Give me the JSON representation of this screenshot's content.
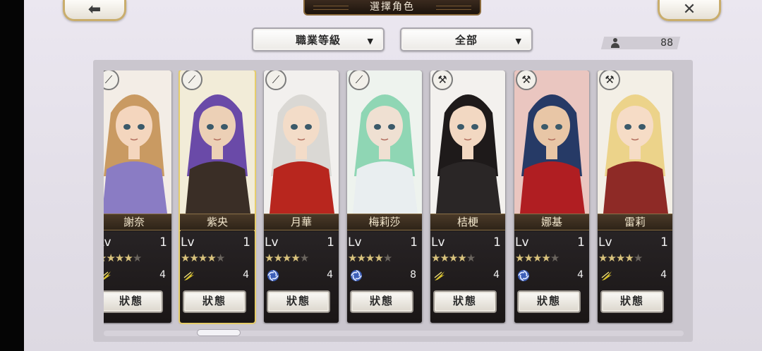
{
  "header": {
    "title": "選擇角色"
  },
  "nav": {
    "back_glyph": "⬅",
    "close_glyph": "✕"
  },
  "filters": {
    "job_level": "職業等級",
    "category": "全部",
    "arrow": "▼"
  },
  "roster": {
    "count": "88"
  },
  "colors": {
    "accent_gold": "#e6cd6a",
    "panel": "#cac6ce",
    "background": "#e7e3ec",
    "star_on": "#d8c27c",
    "star_off": "#6a655e"
  },
  "characters": [
    {
      "name": "謝奈",
      "lv_label": "Lv",
      "level": "1",
      "stars": 4,
      "max_stars": 5,
      "element": "wind",
      "element_icon": "wind-icon",
      "element_value": "4",
      "status": "狀態",
      "weapon_icon": "sword-icon",
      "selected": false
    },
    {
      "name": "紫央",
      "lv_label": "Lv",
      "level": "1",
      "stars": 4,
      "max_stars": 5,
      "element": "wind",
      "element_icon": "wind-icon",
      "element_value": "4",
      "status": "狀態",
      "weapon_icon": "sword-icon",
      "selected": true
    },
    {
      "name": "月華",
      "lv_label": "Lv",
      "level": "1",
      "stars": 4,
      "max_stars": 5,
      "element": "water",
      "element_icon": "vortex-icon",
      "element_value": "4",
      "status": "狀態",
      "weapon_icon": "sword-icon",
      "selected": false
    },
    {
      "name": "梅莉莎",
      "lv_label": "Lv",
      "level": "1",
      "stars": 4,
      "max_stars": 5,
      "element": "water",
      "element_icon": "vortex-icon",
      "element_value": "8",
      "status": "狀態",
      "weapon_icon": "sword-icon",
      "selected": false
    },
    {
      "name": "桔梗",
      "lv_label": "Lv",
      "level": "1",
      "stars": 4,
      "max_stars": 5,
      "element": "wind",
      "element_icon": "wind-icon",
      "element_value": "4",
      "status": "狀態",
      "weapon_icon": "axe-icon",
      "selected": false
    },
    {
      "name": "娜基",
      "lv_label": "Lv",
      "level": "1",
      "stars": 4,
      "max_stars": 5,
      "element": "water",
      "element_icon": "vortex-icon",
      "element_value": "4",
      "status": "狀態",
      "weapon_icon": "axe-icon",
      "selected": false
    },
    {
      "name": "雷莉",
      "lv_label": "Lv",
      "level": "1",
      "stars": 4,
      "max_stars": 5,
      "element": "wind",
      "element_icon": "wind-icon",
      "element_value": "4",
      "status": "狀態",
      "weapon_icon": "axe-icon",
      "selected": false
    }
  ]
}
